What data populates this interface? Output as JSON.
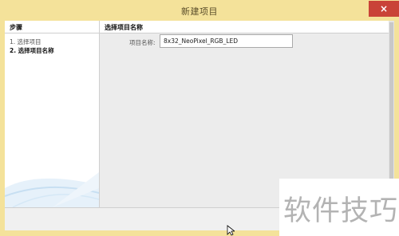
{
  "window": {
    "title": "新建项目",
    "close_label": "×"
  },
  "sidebar": {
    "heading": "步骤",
    "steps": [
      {
        "label": "1. 选择项目"
      },
      {
        "label": "2. 选择项目名称"
      }
    ]
  },
  "main": {
    "heading": "选择项目名称",
    "field_label": "项目名称:",
    "field_value": "8x32_NeoPixel_RGB_LED"
  },
  "watermark": {
    "text": "软件技巧"
  },
  "colors": {
    "frame": "#f4e29a",
    "close": "#c94338",
    "panel": "#ececec"
  }
}
